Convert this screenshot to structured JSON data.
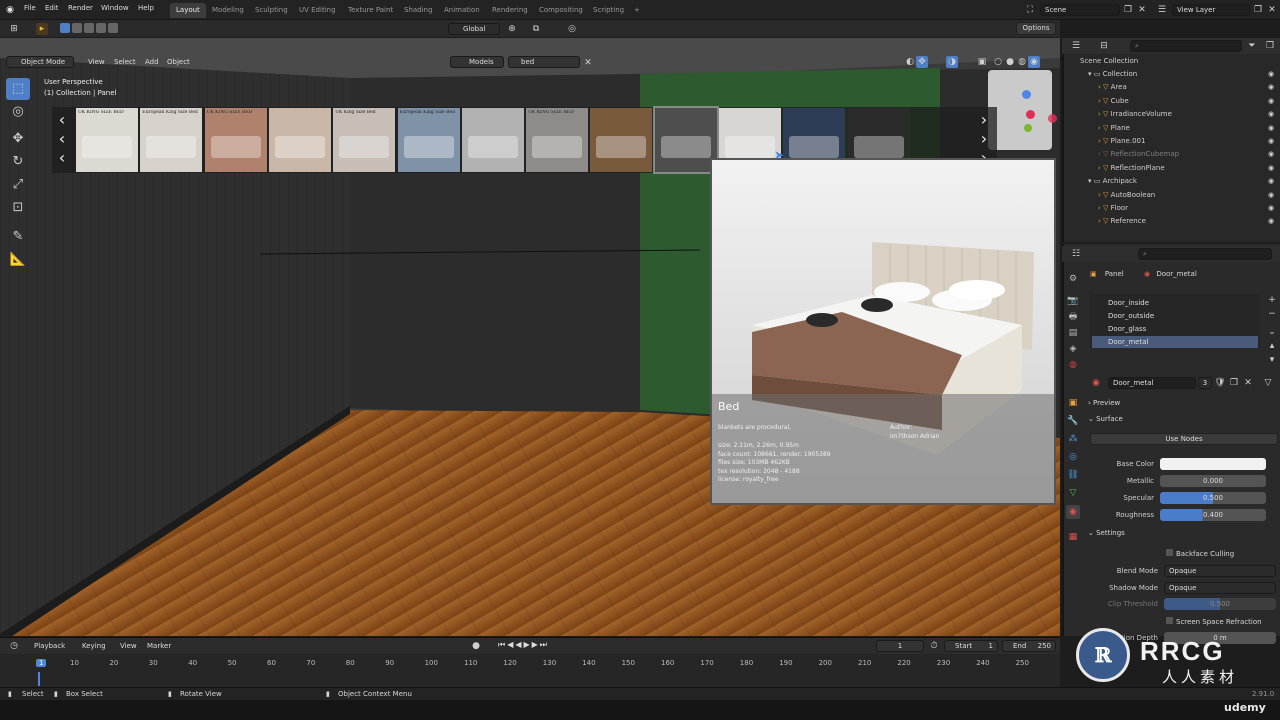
{
  "menu": [
    "File",
    "Edit",
    "Render",
    "Window",
    "Help"
  ],
  "workspaces": [
    "Layout",
    "Modeling",
    "Sculpting",
    "UV Editing",
    "Texture Paint",
    "Shading",
    "Animation",
    "Rendering",
    "Compositing",
    "Scripting",
    "+"
  ],
  "scene": {
    "label": "Scene",
    "view_layer": "View Layer"
  },
  "header": {
    "transform": "Global",
    "options": "Options"
  },
  "vp_menu": {
    "mode": "Object Mode",
    "items": [
      "View",
      "Select",
      "Add",
      "Object"
    ]
  },
  "search": {
    "category": "Models",
    "query": "bed"
  },
  "viewport_info": {
    "line1": "User Perspective",
    "line2": "(1) Collection | Panel"
  },
  "thumbnails": [
    {
      "label": "UK KING SIZE BED",
      "color": "#dcd8d2"
    },
    {
      "label": "European King Size Bed",
      "color": "#d7d1cb"
    },
    {
      "label": "UK KING SIZE BED",
      "color": "#b0826e"
    },
    {
      "label": "",
      "color": "#c9b7aa"
    },
    {
      "label": "UK King Size Bed",
      "color": "#c7beb8"
    },
    {
      "label": "European King Size Bed",
      "color": "#8092a8"
    },
    {
      "label": "",
      "color": "#b2b2b2"
    },
    {
      "label": "UK KING SIZE BED",
      "color": "#8e8b88"
    },
    {
      "label": "",
      "color": "#7a5a3c"
    },
    {
      "label": "",
      "color": "#4e4e4e"
    },
    {
      "label": "",
      "color": "#d8d6d3"
    },
    {
      "label": "",
      "color": "#2e3c55"
    },
    {
      "label": "",
      "color": "#2b2b2b"
    }
  ],
  "preview": {
    "title": "Bed",
    "description": "blankets are procedural,",
    "author_label": "Author:",
    "author": "im7thson Adrian",
    "details": [
      "size: 2.11m, 2.26m, 0.95m",
      "face count: 108661, render: 1905389",
      "files size: 103MB 462KB",
      "tex resolution: 2048 - 4188",
      "license: royalty_free"
    ]
  },
  "outliner": {
    "title": "Scene Collection",
    "items": [
      {
        "label": "Collection",
        "indent": 1
      },
      {
        "label": "Area",
        "indent": 2
      },
      {
        "label": "Cube",
        "indent": 2
      },
      {
        "label": "IrradianceVolume",
        "indent": 2
      },
      {
        "label": "Plane",
        "indent": 2
      },
      {
        "label": "Plane.001",
        "indent": 2
      },
      {
        "label": "ReflectionCubemap",
        "indent": 2
      },
      {
        "label": "ReflectionPlane",
        "indent": 2
      },
      {
        "label": "Archipack",
        "indent": 1
      },
      {
        "label": "AutoBoolean",
        "indent": 2
      },
      {
        "label": "Floor",
        "indent": 2
      },
      {
        "label": "Reference",
        "indent": 2
      }
    ]
  },
  "properties": {
    "object": "Panel",
    "material": "Door_metal",
    "slots": [
      "Door_inside",
      "Door_outside",
      "Door_glass",
      "Door_metal"
    ],
    "material_field": "Door_metal",
    "users": "3",
    "sections": {
      "preview": "Preview",
      "surface": "Surface",
      "settings": "Settings"
    },
    "use_nodes": "Use Nodes",
    "base_color_label": "Base Color",
    "metallic_label": "Metallic",
    "metallic": "0.000",
    "specular_label": "Specular",
    "specular": "0.500",
    "roughness_label": "Roughness",
    "roughness": "0.400",
    "backface": "Backface Culling",
    "blend_label": "Blend Mode",
    "blend": "Opaque",
    "shadow_label": "Shadow Mode",
    "shadow": "Opaque",
    "clip_label": "Clip Threshold",
    "clip": "0.500",
    "ssr": "Screen Space Refraction",
    "refraction_depth": "Refraction Depth",
    "refraction_value": "0 m"
  },
  "timeline": {
    "menus": [
      "Playback",
      "Keying",
      "View",
      "Marker"
    ],
    "frame": "1",
    "start_label": "Start",
    "start": "1",
    "end_label": "End",
    "end": "250",
    "ticks": [
      "1",
      "10",
      "20",
      "30",
      "40",
      "50",
      "60",
      "70",
      "80",
      "90",
      "100",
      "110",
      "120",
      "130",
      "140",
      "150",
      "160",
      "170",
      "180",
      "190",
      "200",
      "210",
      "220",
      "230",
      "240",
      "250"
    ]
  },
  "statusbar": {
    "select": "Select",
    "box_select": "Box Select",
    "rotate": "Rotate View",
    "context": "Object Context Menu",
    "version": "2.91.0"
  },
  "watermark": {
    "brand": "RRCG",
    "sub": "人人素材",
    "udemy": "udemy"
  }
}
